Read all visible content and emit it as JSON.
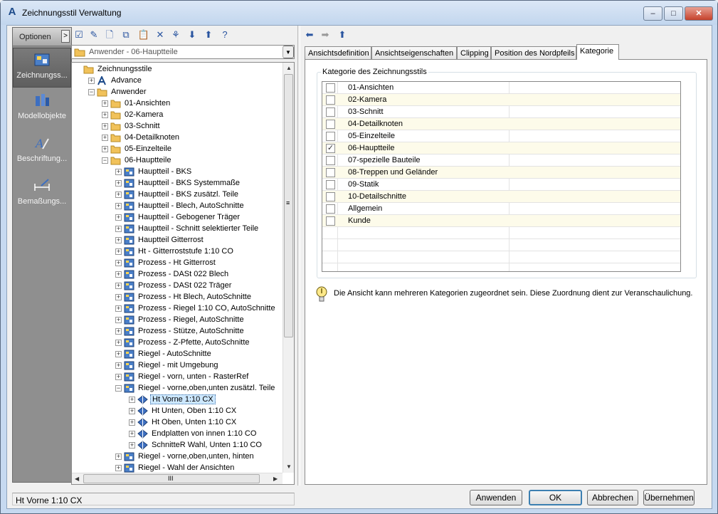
{
  "window": {
    "title": "Zeichnungsstil Verwaltung"
  },
  "nav": {
    "header": "Optionen",
    "toggle_glyph": ">",
    "items": [
      {
        "label": "Zeichnungss...",
        "icon": "display-styles-icon"
      },
      {
        "label": "Modellobjekte",
        "icon": "model-objects-icon"
      },
      {
        "label": "Beschriftung...",
        "icon": "annotation-icon"
      },
      {
        "label": "Bemaßungs...",
        "icon": "dimension-icon"
      }
    ]
  },
  "toolbar": {
    "left": [
      "checkbox-icon",
      "edit-icon",
      "new-style-icon",
      "copy-icon",
      "paste-icon",
      "delete-icon",
      "purge-icon",
      "import-icon",
      "export-icon",
      "help-icon"
    ],
    "right": [
      "back-arrow-icon",
      "forward-arrow-icon",
      "up-arrow-icon"
    ]
  },
  "style_dropdown": {
    "value": "Anwender - 06-Hauptteile"
  },
  "tree": {
    "rows": [
      {
        "label": "Zeichnungsstile",
        "level": 0,
        "icon": "folder",
        "exp": ""
      },
      {
        "label": "Advance",
        "level": 1,
        "icon": "app",
        "exp": "+"
      },
      {
        "label": "Anwender",
        "level": 1,
        "icon": "folder",
        "exp": "-"
      },
      {
        "label": "01-Ansichten",
        "level": 2,
        "icon": "folder",
        "exp": "+"
      },
      {
        "label": "02-Kamera",
        "level": 2,
        "icon": "folder",
        "exp": "+"
      },
      {
        "label": "03-Schnitt",
        "level": 2,
        "icon": "folder",
        "exp": "+"
      },
      {
        "label": "04-Detailknoten",
        "level": 2,
        "icon": "folder",
        "exp": "+"
      },
      {
        "label": "05-Einzelteile",
        "level": 2,
        "icon": "folder",
        "exp": "+"
      },
      {
        "label": "06-Hauptteile",
        "level": 2,
        "icon": "folder",
        "exp": "-"
      },
      {
        "label": "Hauptteil - BKS",
        "level": 3,
        "icon": "style",
        "exp": "+"
      },
      {
        "label": "Hauptteil - BKS Systemmaße",
        "level": 3,
        "icon": "style",
        "exp": "+"
      },
      {
        "label": "Hauptteil - BKS zusätzl. Teile",
        "level": 3,
        "icon": "style",
        "exp": "+"
      },
      {
        "label": "Hauptteil - Blech, AutoSchnitte",
        "level": 3,
        "icon": "style",
        "exp": "+"
      },
      {
        "label": "Hauptteil - Gebogener Träger",
        "level": 3,
        "icon": "style",
        "exp": "+"
      },
      {
        "label": "Hauptteil - Schnitt selektierter Teile",
        "level": 3,
        "icon": "style",
        "exp": "+"
      },
      {
        "label": "Hauptteil Gitterrost",
        "level": 3,
        "icon": "style",
        "exp": "+"
      },
      {
        "label": "Ht - Gitterroststufe 1:10 CO",
        "level": 3,
        "icon": "style",
        "exp": "+"
      },
      {
        "label": "Prozess - Ht Gitterrost",
        "level": 3,
        "icon": "style",
        "exp": "+"
      },
      {
        "label": "Prozess - DASt 022 Blech",
        "level": 3,
        "icon": "style",
        "exp": "+"
      },
      {
        "label": "Prozess - DASt 022 Träger",
        "level": 3,
        "icon": "style",
        "exp": "+"
      },
      {
        "label": "Prozess - Ht Blech, AutoSchnitte",
        "level": 3,
        "icon": "style",
        "exp": "+"
      },
      {
        "label": "Prozess - Riegel 1:10 CO, AutoSchnitte",
        "level": 3,
        "icon": "style",
        "exp": "+"
      },
      {
        "label": "Prozess - Riegel, AutoSchnitte",
        "level": 3,
        "icon": "style",
        "exp": "+"
      },
      {
        "label": "Prozess - Stütze, AutoSchnitte",
        "level": 3,
        "icon": "style",
        "exp": "+"
      },
      {
        "label": "Prozess - Z-Pfette, AutoSchnitte",
        "level": 3,
        "icon": "style",
        "exp": "+"
      },
      {
        "label": "Riegel - AutoSchnitte",
        "level": 3,
        "icon": "style",
        "exp": "+"
      },
      {
        "label": "Riegel - mit Umgebung",
        "level": 3,
        "icon": "style",
        "exp": "+"
      },
      {
        "label": "Riegel - vorn, unten - RasterRef",
        "level": 3,
        "icon": "style",
        "exp": "+"
      },
      {
        "label": "Riegel - vorne,oben,unten zusätzl. Teile",
        "level": 3,
        "icon": "style",
        "exp": "-"
      },
      {
        "label": "Ht Vorne 1:10 CX",
        "level": 4,
        "icon": "view",
        "exp": "+",
        "selected": true
      },
      {
        "label": "Ht Unten, Oben 1:10 CX",
        "level": 4,
        "icon": "view",
        "exp": "+"
      },
      {
        "label": "Ht Oben, Unten 1:10 CX",
        "level": 4,
        "icon": "view",
        "exp": "+"
      },
      {
        "label": "Endplatten von innen 1:10 CO",
        "level": 4,
        "icon": "view",
        "exp": "+"
      },
      {
        "label": "SchnitteR Wahl, Unten 1:10 CO",
        "level": 4,
        "icon": "view",
        "exp": "+"
      },
      {
        "label": "Riegel - vorne,oben,unten, hinten",
        "level": 3,
        "icon": "style",
        "exp": "+"
      },
      {
        "label": "Riegel - Wahl der Ansichten",
        "level": 3,
        "icon": "style",
        "exp": "+"
      }
    ],
    "hscroll_glyph": "III",
    "vscroll_glyph": "≡"
  },
  "tabs": [
    {
      "label": "Ansichtsdefinition",
      "active": false
    },
    {
      "label": "Ansichtseigenschaften",
      "active": false
    },
    {
      "label": "Clipping",
      "active": false
    },
    {
      "label": "Position des Nordpfeils",
      "active": false
    },
    {
      "label": "Kategorie",
      "active": true
    }
  ],
  "kategorie": {
    "group_title": "Kategorie des Zeichnungsstils",
    "rows": [
      {
        "label": "01-Ansichten",
        "checked": false
      },
      {
        "label": "02-Kamera",
        "checked": false
      },
      {
        "label": "03-Schnitt",
        "checked": false
      },
      {
        "label": "04-Detailknoten",
        "checked": false
      },
      {
        "label": "05-Einzelteile",
        "checked": false
      },
      {
        "label": "06-Hauptteile",
        "checked": true
      },
      {
        "label": "07-spezielle Bauteile",
        "checked": false
      },
      {
        "label": "08-Treppen und Geländer",
        "checked": false
      },
      {
        "label": "09-Statik",
        "checked": false
      },
      {
        "label": "10-Detailschnitte",
        "checked": false
      },
      {
        "label": "Allgemein",
        "checked": false
      },
      {
        "label": "Kunde",
        "checked": false
      }
    ],
    "hint": "Die Ansicht kann mehreren Kategorien zugeordnet sein. Diese Zuordnung dient zur Veranschaulichung."
  },
  "status": {
    "text": "Ht Vorne 1:10 CX"
  },
  "buttons": {
    "apply": "Anwenden",
    "ok": "OK",
    "cancel": "Abbrechen",
    "adopt": "Übernehmen"
  },
  "colors": {
    "selection": "#cde8ff",
    "row_alt": "#fdfbea",
    "title_bg": "#c6d9f0",
    "nav_bg": "#8f8f8f"
  }
}
